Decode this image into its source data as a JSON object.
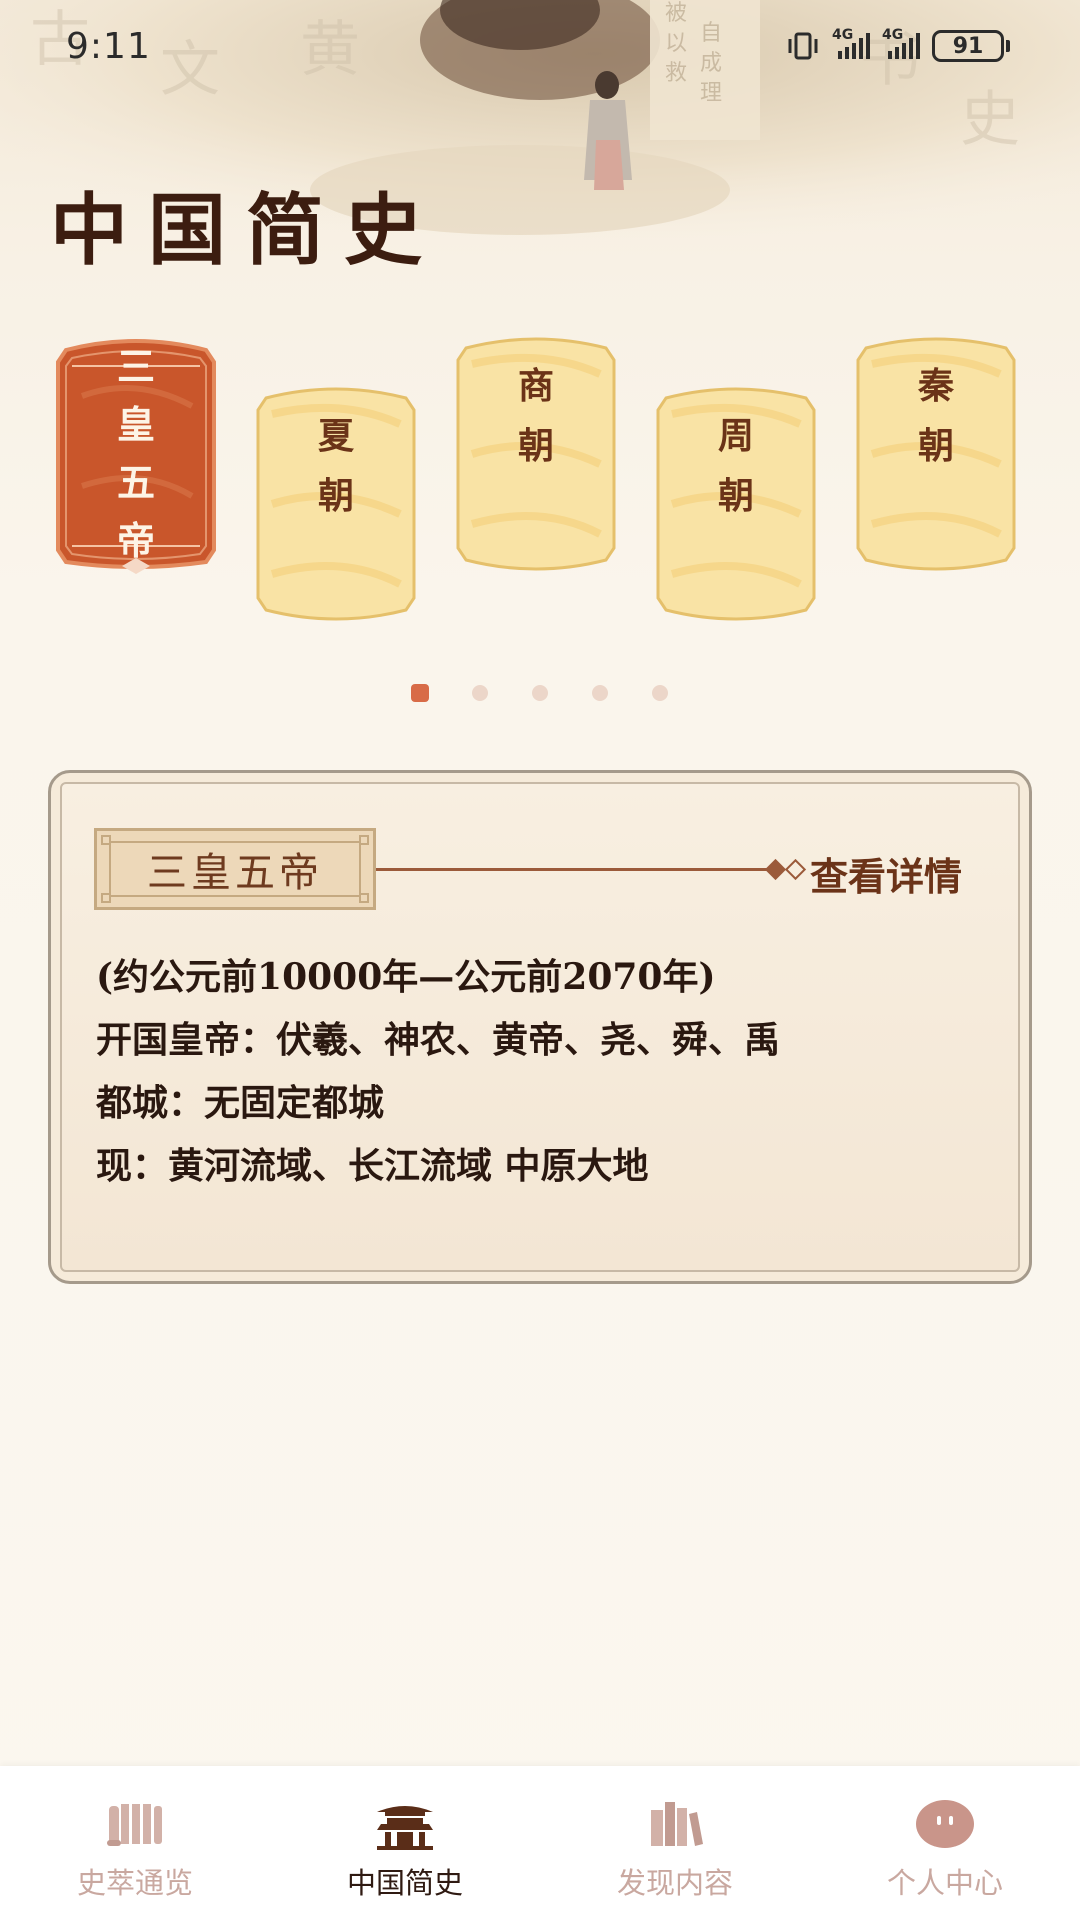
{
  "status_bar": {
    "time": "9:11",
    "network_1": "4G",
    "network_2": "4G",
    "battery": "91"
  },
  "page_title": "中国简史",
  "dynasty_cards": [
    {
      "chars": [
        "三",
        "皇",
        "五",
        "帝"
      ],
      "active": true
    },
    {
      "chars": [
        "夏",
        "朝"
      ],
      "active": false
    },
    {
      "chars": [
        "商",
        "朝"
      ],
      "active": false
    },
    {
      "chars": [
        "周",
        "朝"
      ],
      "active": false
    },
    {
      "chars": [
        "秦",
        "朝"
      ],
      "active": false
    }
  ],
  "pager": {
    "count": 5,
    "active_index": 0
  },
  "detail": {
    "tag": "三皇五帝",
    "link": "查看详情",
    "lines": [
      "(约公元前10000年—公元前2070年)",
      "开国皇帝：伏羲、神农、黄帝、尧、舜、禹",
      "都城：无固定都城",
      "现：黄河流域、长江流域 中原大地"
    ]
  },
  "nav": [
    {
      "label": "史萃通览",
      "icon": "scroll-icon",
      "active": false
    },
    {
      "label": "中国简史",
      "icon": "pavilion-icon",
      "active": true
    },
    {
      "label": "发现内容",
      "icon": "books-icon",
      "active": false
    },
    {
      "label": "个人中心",
      "icon": "face-bubble-icon",
      "active": false
    }
  ],
  "colors": {
    "accent": "#d86b47",
    "brown": "#6b3318",
    "card_gold": "#f7d98a",
    "nav_inactive": "#c9a8a0"
  }
}
